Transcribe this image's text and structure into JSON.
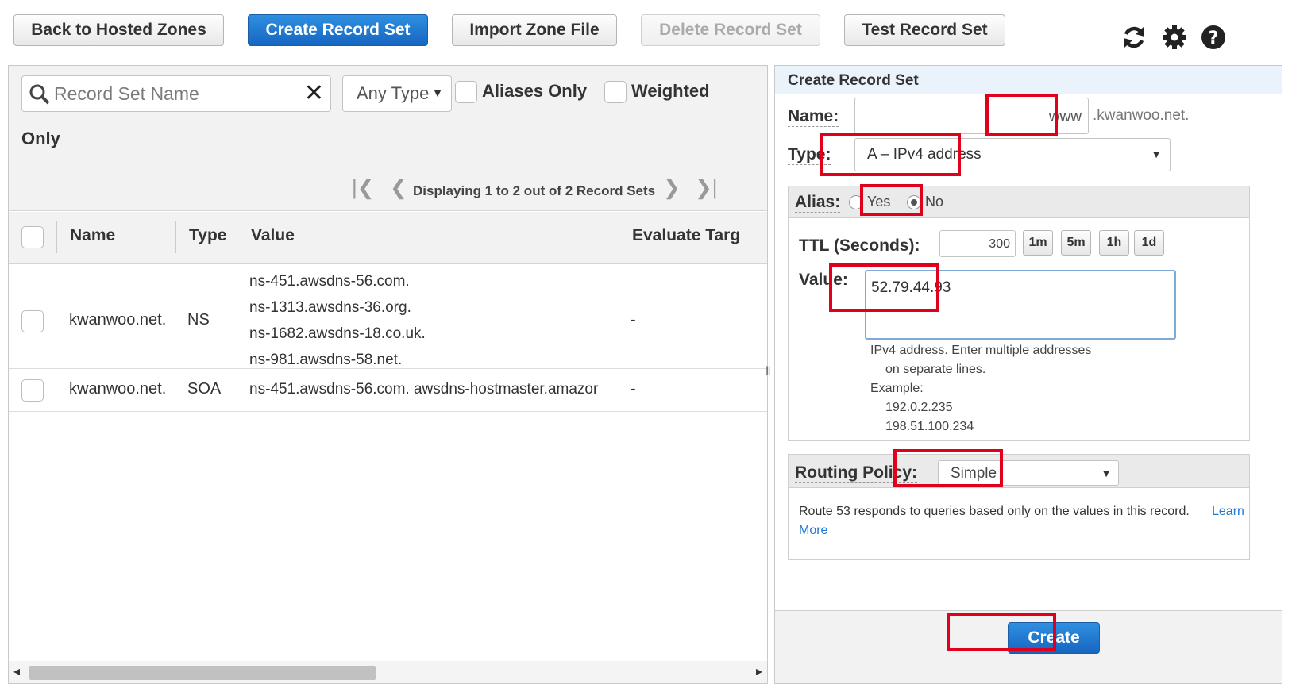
{
  "toolbar": {
    "back_label": "Back to Hosted Zones",
    "create_label": "Create Record Set",
    "import_label": "Import Zone File",
    "delete_label": "Delete Record Set",
    "test_label": "Test Record Set",
    "icons": [
      "refresh-icon",
      "gear-icon",
      "help-icon"
    ]
  },
  "filters": {
    "search_placeholder": "Record Set Name",
    "type_select": "Any Type",
    "aliases_only_label": "Aliases Only",
    "weighted_label": "Weighted",
    "weighted_label_wrap": "Only"
  },
  "pager": {
    "text": "Displaying 1 to 2 out of 2 Record Sets"
  },
  "table": {
    "columns": [
      "Name",
      "Type",
      "Value",
      "Evaluate Targ"
    ],
    "rows": [
      {
        "name": "kwanwoo.net.",
        "type": "NS",
        "values": [
          "ns-451.awsdns-56.com.",
          "ns-1313.awsdns-36.org.",
          "ns-1682.awsdns-18.co.uk.",
          "ns-981.awsdns-58.net."
        ],
        "evaluate": "-"
      },
      {
        "name": "kwanwoo.net.",
        "type": "SOA",
        "values": [
          "ns-451.awsdns-56.com. awsdns-hostmaster.amazor"
        ],
        "evaluate": "-"
      }
    ]
  },
  "form": {
    "title": "Create Record Set",
    "name_label": "Name:",
    "name_value": "www",
    "name_suffix": ".kwanwoo.net.",
    "type_label": "Type:",
    "type_value": "A – IPv4 address",
    "alias_label": "Alias:",
    "alias_yes": "Yes",
    "alias_no": "No",
    "alias_selected": "No",
    "ttl_label": "TTL (Seconds):",
    "ttl_value": "300",
    "ttl_buttons": [
      "1m",
      "5m",
      "1h",
      "1d"
    ],
    "value_label": "Value:",
    "value_text": "52.79.44.93",
    "help_line1": "IPv4 address. Enter multiple addresses",
    "help_line2": "on separate lines.",
    "example_label": "Example:",
    "example_1": "192.0.2.235",
    "example_2": "198.51.100.234",
    "routing_label": "Routing Policy:",
    "routing_value": "Simple",
    "routing_desc": "Route 53 responds to queries based only on the values in this record.",
    "learn": "Learn",
    "more": "More",
    "create_label": "Create"
  },
  "colors": {
    "primary": "#1f78d1",
    "highlight": "#e0001b",
    "panel_header": "#eaf2fb"
  }
}
